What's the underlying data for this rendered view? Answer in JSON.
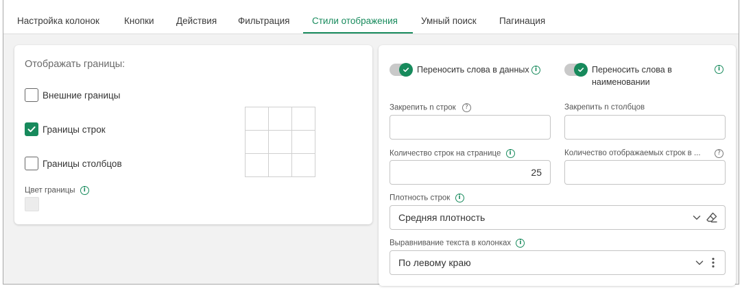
{
  "tabs": [
    {
      "label": "Настройка колонок"
    },
    {
      "label": "Кнопки"
    },
    {
      "label": "Действия"
    },
    {
      "label": "Фильтрация"
    },
    {
      "label": "Стили отображения",
      "active": true
    },
    {
      "label": "Умный поиск"
    },
    {
      "label": "Пагинация"
    }
  ],
  "borders": {
    "title": "Отображать границы:",
    "outer": {
      "label": "Внешние границы",
      "checked": false
    },
    "rows": {
      "label": "Границы строк",
      "checked": true
    },
    "columns": {
      "label": "Границы столбцов",
      "checked": false
    },
    "color_label": "Цвет границы",
    "color_value": "#ececec"
  },
  "settings": {
    "wrap_data": {
      "label": "Переносить слова в данных",
      "on": true
    },
    "wrap_headers": {
      "label": "Переносить слова в наименовании",
      "on": true
    },
    "freeze_rows": {
      "label": "Закрепить n строк",
      "value": ""
    },
    "freeze_cols": {
      "label": "Закрепить n столбцов",
      "value": ""
    },
    "rows_per_page": {
      "label": "Количество строк на странице",
      "value": "25"
    },
    "visible_rows": {
      "label": "Количество отображаемых строк в ...",
      "value": ""
    },
    "density": {
      "label": "Плотность строк",
      "value": "Средняя плотность"
    },
    "alignment": {
      "label": "Выравнивание текста в колонках",
      "value": "По левому краю"
    }
  },
  "colors": {
    "accent": "#178a5c"
  }
}
